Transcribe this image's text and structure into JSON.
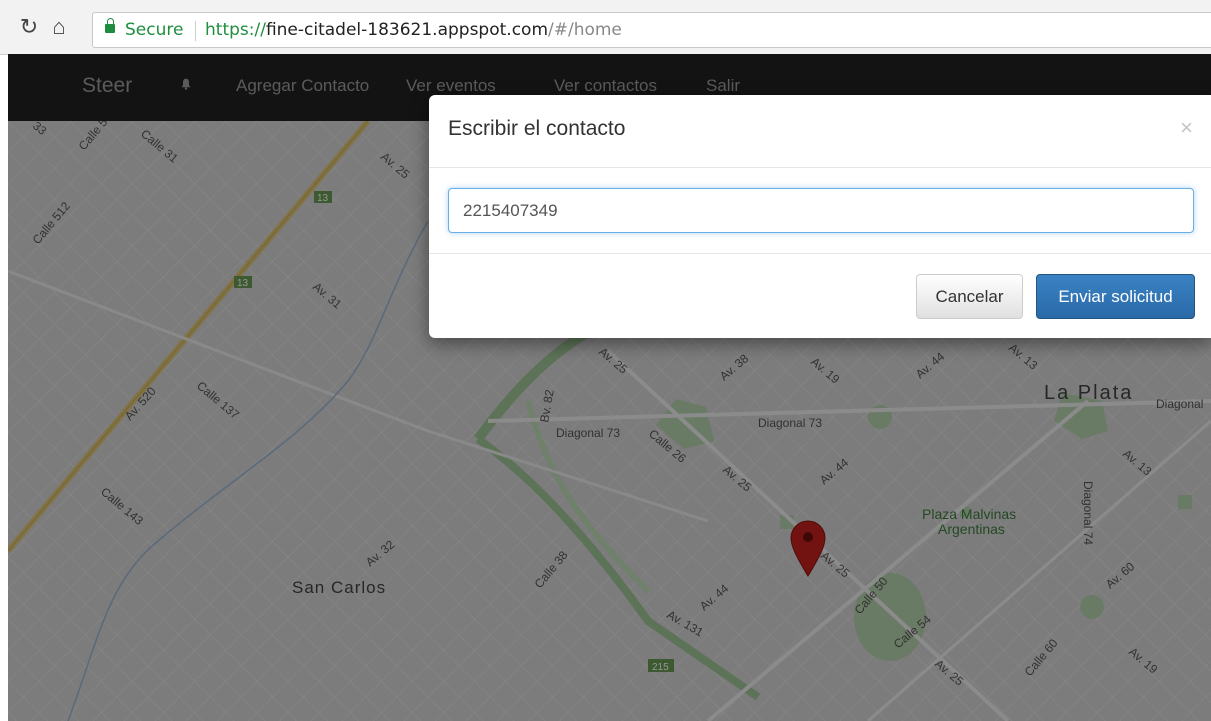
{
  "browser": {
    "secure_label": "Secure",
    "url_scheme": "https://",
    "url_host": "fine-citadel-183621.appspot.com",
    "url_path": "/#/home"
  },
  "navbar": {
    "brand": "Steer",
    "items": [
      {
        "label": "Agregar Contacto"
      },
      {
        "label": "Ver eventos"
      },
      {
        "label": "Ver contactos"
      },
      {
        "label": "Salir"
      }
    ]
  },
  "modal": {
    "title": "Escribir el contacto",
    "close_label": "×",
    "input_value": "2215407349",
    "cancel_label": "Cancelar",
    "submit_label": "Enviar solicitud"
  },
  "map": {
    "labels": {
      "la_plata": "La Plata",
      "san_carlos": "San Carlos",
      "plaza_l1": "Plaza Malvinas",
      "plaza_l2": "Argentinas",
      "av520": "Av. 520",
      "av25a": "Av. 25",
      "av31a": "Av. 31",
      "calle31": "Calle 31",
      "calle512": "Calle 512",
      "calle137": "Calle 137",
      "calle143": "Calle 143",
      "av32": "Av. 32",
      "calle38": "Calle 38",
      "av44a": "Av. 44",
      "av131": "Av. 131",
      "bv82": "Bv. 82",
      "diag73a": "Diagonal 73",
      "diag73b": "Diagonal 73",
      "calle26": "Calle 26",
      "av25b": "Av. 25",
      "av25c": "Av. 25",
      "av25d": "Av. 25",
      "av25e": "Av. 25",
      "av38": "Av. 38",
      "av19a": "Av. 19",
      "av19b": "Av. 19",
      "av44b": "Av. 44",
      "av44c": "Av. 44",
      "av13a": "Av. 13",
      "av13b": "Av. 13",
      "diagonal": "Diagonal",
      "diag74": "Diagonal 74",
      "av60": "Av. 60",
      "calle60": "Calle 60",
      "calle50": "Calle 50",
      "calle54": "Calle 54",
      "calle5": "Calle 5",
      "num33": "33",
      "shield13a": "13",
      "shield13b": "13",
      "shield215": "215"
    }
  },
  "colors": {
    "navbar_bg": "#222222",
    "primary": "#337ab7",
    "secure_green": "#1e8e3e",
    "marker_red": "#c5221f"
  }
}
